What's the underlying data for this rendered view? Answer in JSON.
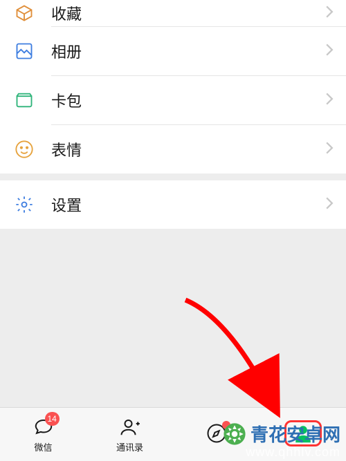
{
  "menu": {
    "favorites": "收藏",
    "album": "相册",
    "cards": "卡包",
    "stickers": "表情",
    "settings": "设置"
  },
  "tabs": {
    "chats": {
      "label": "微信",
      "badge": "14"
    },
    "contacts": {
      "label": "通讯录"
    },
    "discover": {
      "label": ""
    },
    "me": {
      "label": ""
    }
  },
  "watermark": {
    "line1": "青花安卓网",
    "line2": "www.qhhlv.com"
  }
}
